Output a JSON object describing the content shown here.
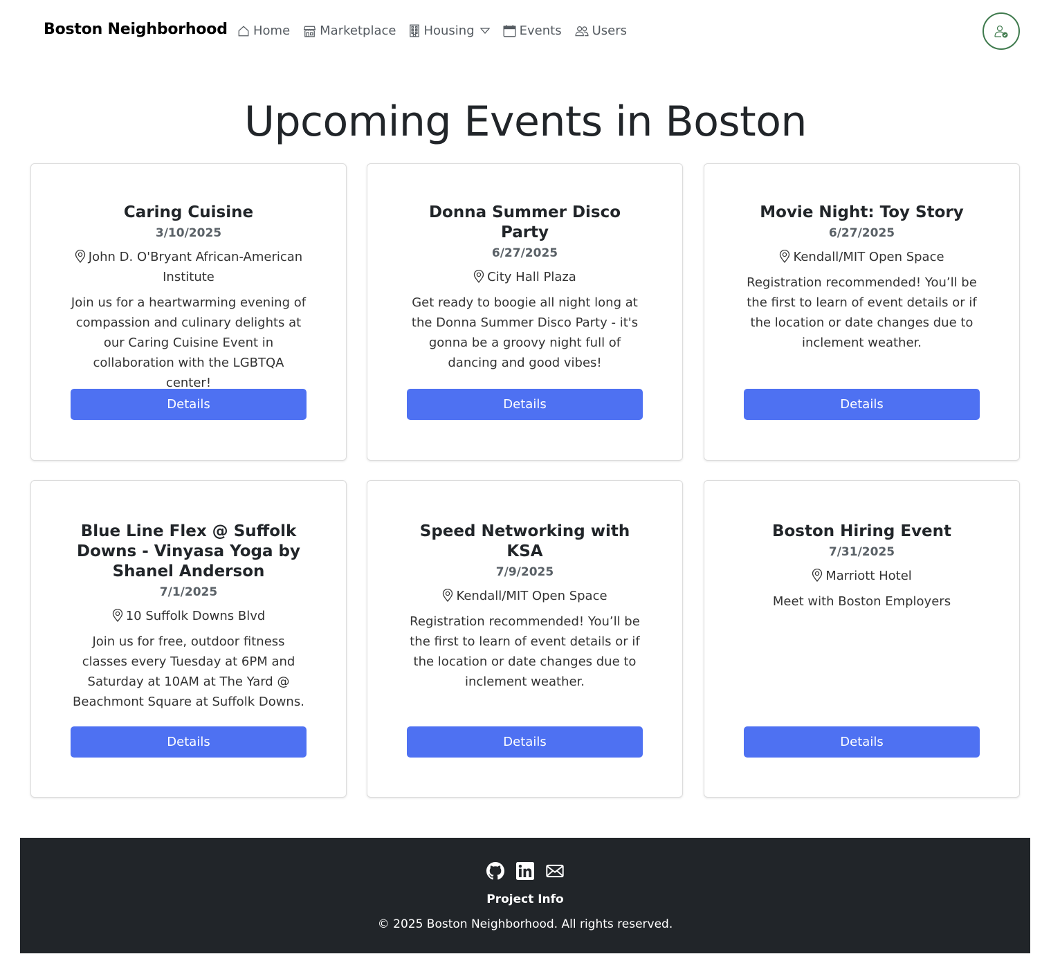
{
  "nav": {
    "brand": "Boston Neighborhood",
    "items": [
      {
        "label": "Home",
        "icon": "home-icon"
      },
      {
        "label": "Marketplace",
        "icon": "shop-icon"
      },
      {
        "label": "Housing",
        "icon": "building-icon"
      },
      {
        "label": "Events",
        "icon": "calendar-icon"
      },
      {
        "label": "Users",
        "icon": "people-icon"
      }
    ],
    "avatar_icon": "user-check-icon"
  },
  "page": {
    "title": "Upcoming Events in Boston"
  },
  "events": [
    {
      "title": "Caring Cuisine",
      "date": "3/10/2025",
      "location": "John D. O'Bryant African-American Institute",
      "description": "Join us for a heartwarming evening of compassion and culinary delights at our Caring Cuisine Event in collaboration with the LGBTQA center!",
      "button": "Details"
    },
    {
      "title": "Donna Summer Disco Party",
      "date": "6/27/2025",
      "location": "City Hall Plaza",
      "description": "Get ready to boogie all night long at the Donna Summer Disco Party - it's gonna be a groovy night full of dancing and good vibes!",
      "button": "Details"
    },
    {
      "title": "Movie Night: Toy Story",
      "date": "6/27/2025",
      "location": "Kendall/MIT Open Space",
      "description": "Registration recommended! You’ll be the first to learn of event details or if the location or date changes due to inclement weather.",
      "button": "Details"
    },
    {
      "title": "Blue Line Flex @ Suffolk Downs - Vinyasa Yoga by Shanel Anderson",
      "date": "7/1/2025",
      "location": "10 Suffolk Downs Blvd",
      "description": "Join us for free, outdoor fitness classes every Tuesday at 6PM and Saturday at 10AM at The Yard @ Beachmont Square at Suffolk Downs.",
      "button": "Details"
    },
    {
      "title": "Speed Networking with KSA",
      "date": "7/9/2025",
      "location": "Kendall/MIT Open Space",
      "description": "Registration recommended! You’ll be the first to learn of event details or if the location or date changes due to inclement weather.",
      "button": "Details"
    },
    {
      "title": "Boston Hiring Event",
      "date": "7/31/2025",
      "location": "Marriott Hotel",
      "description": "Meet with Boston Employers",
      "button": "Details"
    }
  ],
  "footer": {
    "icons": [
      "github-icon",
      "linkedin-icon",
      "envelope-icon"
    ],
    "link": "Project Info",
    "copyright": "© 2025 Boston Neighborhood. All rights reserved."
  },
  "colors": {
    "accent": "#4e71f2",
    "footer_bg": "#212529",
    "avatar_border": "#3f7a4d"
  }
}
